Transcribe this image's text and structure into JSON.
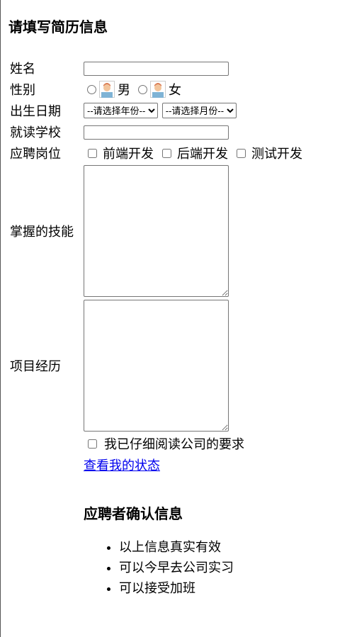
{
  "form": {
    "title": "请填写简历信息",
    "name_label": "姓名",
    "gender_label": "性别",
    "gender_options": [
      "男",
      "女"
    ],
    "birth_label": "出生日期",
    "year_select": "--请选择年份--",
    "month_select": "--请选择月份--",
    "school_label": "就读学校",
    "position_label": "应聘岗位",
    "positions": [
      "前端开发",
      "后端开发",
      "测试开发"
    ],
    "skills_label": "掌握的技能",
    "projects_label": "项目经历",
    "agree_label": "我已仔细阅读公司的要求",
    "status_link": "查看我的状态"
  },
  "confirm": {
    "title": "应聘者确认信息",
    "items": [
      "以上信息真实有效",
      "可以今早去公司实习",
      "可以接受加班"
    ]
  }
}
